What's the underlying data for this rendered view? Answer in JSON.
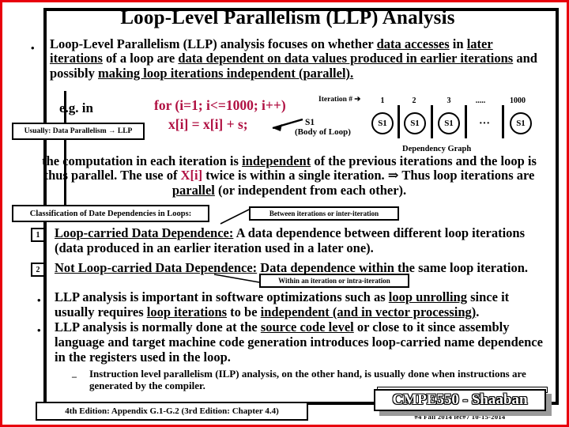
{
  "slide": {
    "title": "Loop-Level Parallelism (LLP) Analysis",
    "border_color": "#e8000d",
    "code_color": "#b01042"
  },
  "intro": {
    "bullet": "•",
    "seg1": "Loop-Level Parallelism (LLP) analysis focuses on whether ",
    "u1": "data accesses",
    "seg2": " in ",
    "u2": "later iterations",
    "seg3": " of a loop are ",
    "u3": "data dependent on data values produced in earlier iterations",
    "seg4": " and possibly ",
    "u4": "making loop iterations independent (parallel)."
  },
  "example": {
    "eg_label": "e.g.  in",
    "for_line": "for (i=1; i<=1000; i++)",
    "body_line": "x[i] = x[i] + s;",
    "s1_label": "S1",
    "body_of_loop": "(Body of Loop)",
    "usually_box": "Usually:   Data Parallelism → LLP"
  },
  "dependency_graph": {
    "iteration_label": "Iteration # ➔",
    "caption": "Dependency Graph",
    "node_label": "S1",
    "ellipsis_label": ".....",
    "ellipsis_nodes": "···",
    "iterations": [
      "1",
      "2",
      "3",
      "1000"
    ]
  },
  "conclusion": {
    "line1_a": "the computation in each iteration is ",
    "line1_u": "independent",
    "line1_b": " of the  previous iterations and the",
    "line2_a": "loop is thus parallel. The use of ",
    "line2_code": "X[i]",
    "line2_b": "  twice is within a single iteration.",
    "line3_a": "⇒ Thus loop iterations are ",
    "line3_u": "parallel",
    "line3_b": " (or independent from each other)."
  },
  "classification": {
    "header_box": "Classification of Date Dependencies in Loops:",
    "callout_between": "Between iterations or inter-iteration",
    "callout_within": "Within an iteration or intra-iteration",
    "item1_num": "1",
    "item1_title": "Loop-carried Data Dependence:",
    "item1_text": "  A data dependence between different loop iterations (data produced in an earlier iteration used in a later one).",
    "item2_num": "2",
    "item2_title": "Not Loop-carried Data Dependence:",
    "item2_text": "  Data dependence within the same loop iteration."
  },
  "bullets": {
    "dot": "•",
    "b3_a": "LLP analysis is important in software optimizations such as  ",
    "b3_u1": "loop unrolling",
    "b3_b": " since it usually requires ",
    "b3_u2": "loop iterations",
    "b3_c": " to be ",
    "b3_u3": "independent (and in vector processing)",
    "b3_d": ".",
    "b4_a": "LLP analysis is normally done at the ",
    "b4_u1": "source code level",
    "b4_b": " or close to it since assembly language and target machine code generation introduces  loop-carried name dependence in the registers used in the loop.",
    "dash": "–",
    "sub1": "Instruction level parallelism (ILP) analysis, on the other hand, is usually done when instructions are generated by the compiler."
  },
  "footer": {
    "edition_box": "4th Edition: Appendix G.1-G.2 (3rd Edition: Chapter 4.4)",
    "edition_sup1": "th",
    "edition_sup2": "rd",
    "course_badge": "CMPE550 - Shaaban",
    "meta": "#4   Fall 2014  lec#7   10-15-2014"
  }
}
